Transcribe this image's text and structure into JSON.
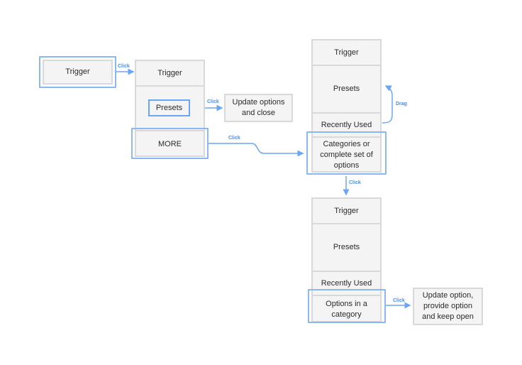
{
  "colors": {
    "accent": "#6aa6f7",
    "box_fill": "#f4f4f4",
    "box_border": "#d9d9d9"
  },
  "stage1": {
    "trigger": "Trigger"
  },
  "stage2": {
    "trigger": "Trigger",
    "presets": "Presets",
    "more": "MORE"
  },
  "stage2_result": "Update options and close",
  "stage3": {
    "trigger": "Trigger",
    "presets": "Presets",
    "recent": "Recently Used",
    "categories": "Categories or complete set of options"
  },
  "stage4": {
    "trigger": "Trigger",
    "presets": "Presets",
    "recent": "Recently Used",
    "options": "Options in a category"
  },
  "stage4_result": "Update option, provide option and keep open",
  "labels": {
    "click1": "Click",
    "click2": "Click",
    "click3": "Click",
    "click4": "Click",
    "click5": "Click",
    "drag": "Drag"
  }
}
